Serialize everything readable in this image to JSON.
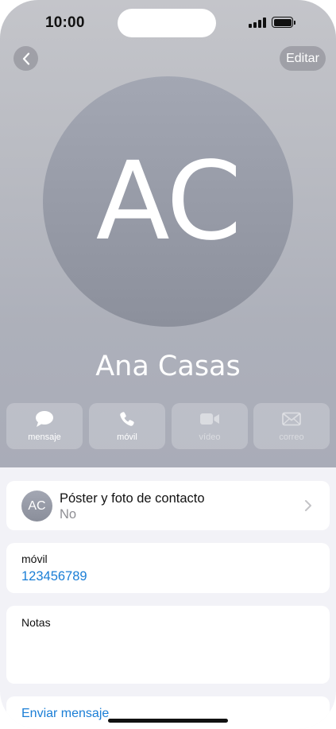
{
  "status_bar": {
    "time": "10:00"
  },
  "nav": {
    "edit_label": "Editar"
  },
  "contact": {
    "initials": "AC",
    "name": "Ana Casas"
  },
  "actions": [
    {
      "label": "mensaje",
      "icon": "message-icon",
      "enabled": true
    },
    {
      "label": "móvil",
      "icon": "phone-icon",
      "enabled": true
    },
    {
      "label": "vídeo",
      "icon": "video-icon",
      "enabled": false
    },
    {
      "label": "correo",
      "icon": "mail-icon",
      "enabled": false
    }
  ],
  "poster": {
    "title": "Póster y foto de contacto",
    "value": "No",
    "initials": "AC"
  },
  "phone_field": {
    "label": "móvil",
    "number": "123456789"
  },
  "notes": {
    "label": "Notas"
  },
  "send_message": {
    "label": "Enviar mensaje"
  },
  "colors": {
    "link": "#1a7ed6",
    "background": "#f2f2f7"
  }
}
